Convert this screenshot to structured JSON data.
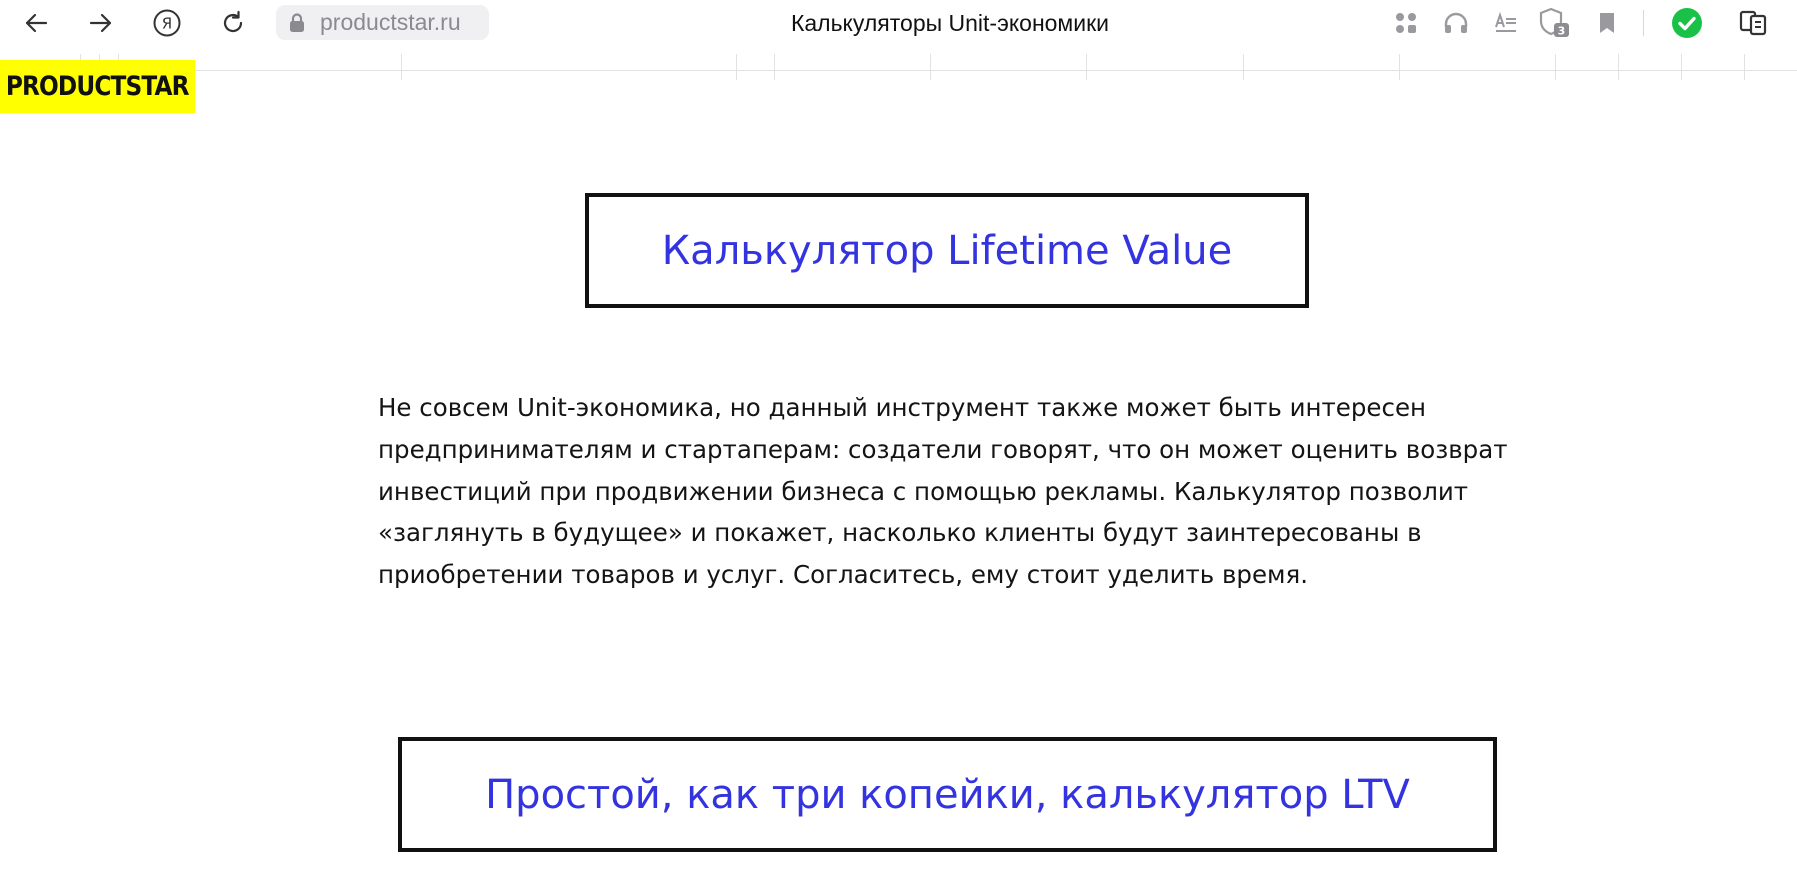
{
  "browser": {
    "url": "productstar.ru",
    "tab_title": "Калькуляторы Unit-экономики",
    "shield_count": "3"
  },
  "page": {
    "logo_text": "PRODUCTSTAR",
    "heading_1": "Калькулятор Lifetime Value",
    "paragraph": "Не совсем Unit-экономика, но данный инструмент также может быть интересен предпринимателям и стартаперам: создатели говорят, что он может оценить возврат инвестиций при продвижении бизнеса с помощью рекламы. Калькулятор позволит «заглянуть в будущее» и покажет, насколько клиенты будут заинтересованы в приобретении товаров и услуг. Согласитесь, ему стоит уделить время.",
    "heading_2": "Простой, как три копейки, калькулятор LTV"
  },
  "colors": {
    "heading": "#3333e0",
    "logo_bg": "#ffff00",
    "verified": "#19c246"
  }
}
